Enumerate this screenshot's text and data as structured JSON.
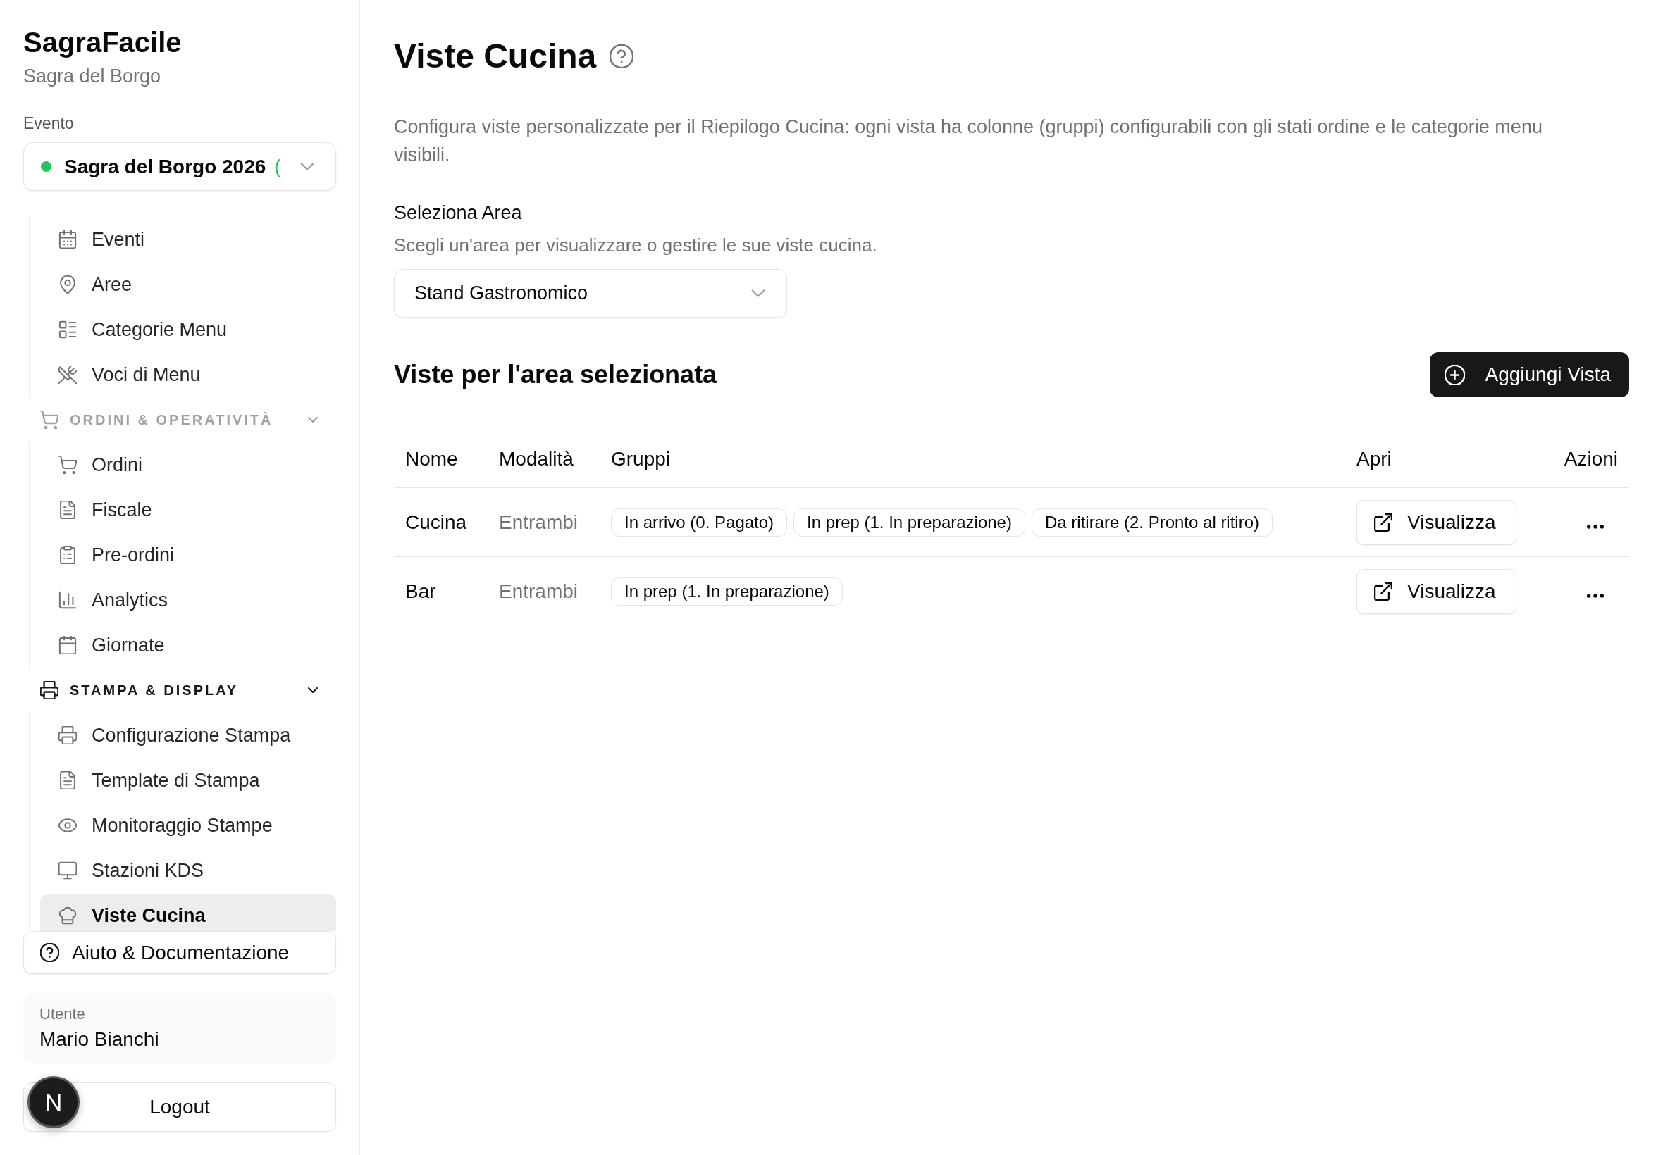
{
  "sidebar": {
    "app_title": "SagraFacile",
    "app_subtitle": "Sagra del Borgo",
    "event_label": "Evento",
    "event_select": {
      "value": "Sagra del Borgo 2026",
      "status": "(",
      "active": true
    },
    "nav_groups": [
      {
        "items": [
          {
            "label": "Eventi",
            "selected": false
          },
          {
            "label": "Aree",
            "selected": false
          },
          {
            "label": "Categorie Menu",
            "selected": false
          },
          {
            "label": "Voci di Menu",
            "selected": false
          }
        ]
      },
      {
        "label": "ORDINI & OPERATIVITÀ",
        "active": false,
        "expanded": true,
        "items": [
          {
            "label": "Ordini",
            "selected": false
          },
          {
            "label": "Fiscale",
            "selected": false
          },
          {
            "label": "Pre-ordini",
            "selected": false
          },
          {
            "label": "Analytics",
            "selected": false
          },
          {
            "label": "Giornate",
            "selected": false
          }
        ]
      },
      {
        "label": "STAMPA & DISPLAY",
        "active": true,
        "expanded": true,
        "items": [
          {
            "label": "Configurazione Stampa",
            "selected": false
          },
          {
            "label": "Template di Stampa",
            "selected": false
          },
          {
            "label": "Monitoraggio Stampe",
            "selected": false
          },
          {
            "label": "Stazioni KDS",
            "selected": false
          },
          {
            "label": "Viste Cucina",
            "selected": true
          }
        ]
      }
    ],
    "help_button": "Aiuto & Documentazione",
    "user": {
      "label": "Utente",
      "name": "Mario Bianchi"
    },
    "logout_button": "Logout"
  },
  "dev_badge": {
    "label": "N"
  },
  "main": {
    "title": "Viste Cucina",
    "description": "Configura viste personalizzate per il Riepilogo Cucina: ogni vista ha colonne (gruppi) configurabili con gli stati ordine e le categorie menu visibili.",
    "area_field": {
      "label": "Seleziona Area",
      "hint": "Scegli un'area per visualizzare o gestire le sue viste cucina.",
      "value": "Stand Gastronomico"
    },
    "section_title": "Viste per l'area selezionata",
    "add_button": "Aggiungi Vista",
    "table": {
      "columns": [
        "Nome",
        "Modalità",
        "Gruppi",
        "Apri",
        "Azioni"
      ],
      "rows": [
        {
          "name": "Cucina",
          "mode": "Entrambi",
          "groups": [
            "In arrivo (0. Pagato)",
            "In prep (1. In preparazione)",
            "Da ritirare (2. Pronto al ritiro)"
          ],
          "open_button": "Visualizza"
        },
        {
          "name": "Bar",
          "mode": "Entrambi",
          "groups": [
            "In prep (1. In preparazione)"
          ],
          "open_button": "Visualizza"
        }
      ]
    }
  }
}
